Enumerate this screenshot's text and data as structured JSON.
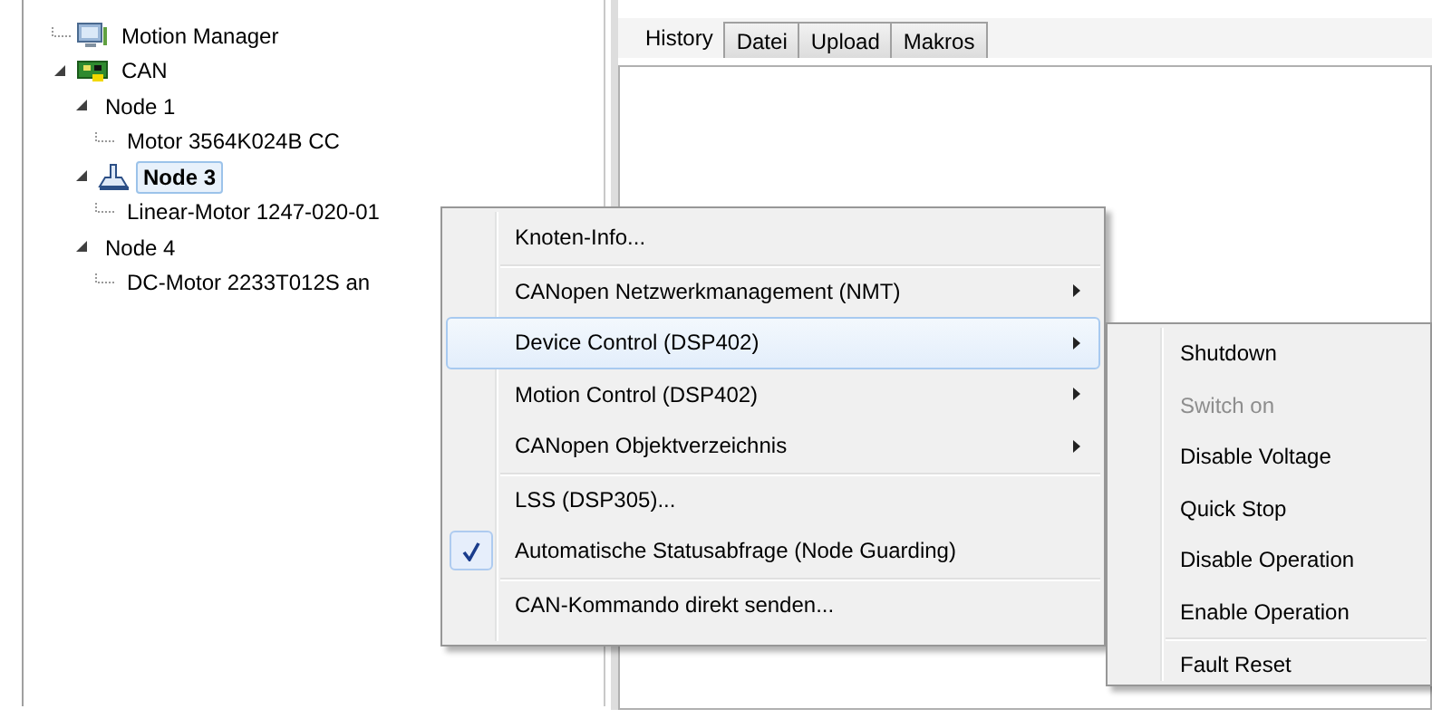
{
  "tree": [
    {
      "label": "Motion Manager",
      "kind": "computer",
      "expanded": false,
      "selected": false
    },
    {
      "label": "CAN",
      "kind": "bus",
      "expanded": true,
      "selected": false,
      "children": [
        {
          "label": "Node 1",
          "expanded": true,
          "selected": false,
          "children": [
            {
              "label": "Motor 3564K024B CC",
              "expanded": false,
              "selected": false
            }
          ]
        },
        {
          "label": "Node 3",
          "kind": "active-node",
          "expanded": true,
          "selected": true,
          "children": [
            {
              "label": "Linear-Motor 1247-020-01",
              "expanded": false,
              "selected": false
            }
          ]
        },
        {
          "label": "Node 4",
          "expanded": true,
          "selected": false,
          "children": [
            {
              "label": "DC-Motor 2233T012S an",
              "expanded": false,
              "selected": false
            }
          ]
        }
      ]
    }
  ],
  "tabs": [
    {
      "label": "History",
      "selected": true
    },
    {
      "label": "Datei",
      "selected": false
    },
    {
      "label": "Upload",
      "selected": false
    },
    {
      "label": "Makros",
      "selected": false
    }
  ],
  "context_menu": {
    "groups": [
      [
        {
          "label": "Knoten-Info...",
          "submenu": false,
          "checked": false,
          "selected": false
        }
      ],
      [
        {
          "label": "CANopen Netzwerkmanagement (NMT)",
          "submenu": true,
          "checked": false,
          "selected": false
        },
        {
          "label": "Device Control (DSP402)",
          "submenu": true,
          "checked": false,
          "selected": true
        },
        {
          "label": "Motion Control (DSP402)",
          "submenu": true,
          "checked": false,
          "selected": false
        },
        {
          "label": "CANopen Objektverzeichnis",
          "submenu": true,
          "checked": false,
          "selected": false
        }
      ],
      [
        {
          "label": "LSS (DSP305)...",
          "submenu": false,
          "checked": false,
          "selected": false
        },
        {
          "label": "Automatische Statusabfrage (Node Guarding)",
          "submenu": false,
          "checked": true,
          "selected": false
        }
      ],
      [
        {
          "label": "CAN-Kommando direkt senden...",
          "submenu": false,
          "checked": false,
          "selected": false
        }
      ]
    ]
  },
  "submenu": {
    "groups": [
      [
        {
          "label": "Shutdown",
          "disabled": false
        },
        {
          "label": "Switch on",
          "disabled": true
        },
        {
          "label": "Disable Voltage",
          "disabled": false
        },
        {
          "label": "Quick Stop",
          "disabled": false
        },
        {
          "label": "Disable Operation",
          "disabled": false
        },
        {
          "label": "Enable Operation",
          "disabled": false
        }
      ],
      [
        {
          "label": "Fault Reset",
          "disabled": false
        }
      ]
    ]
  }
}
